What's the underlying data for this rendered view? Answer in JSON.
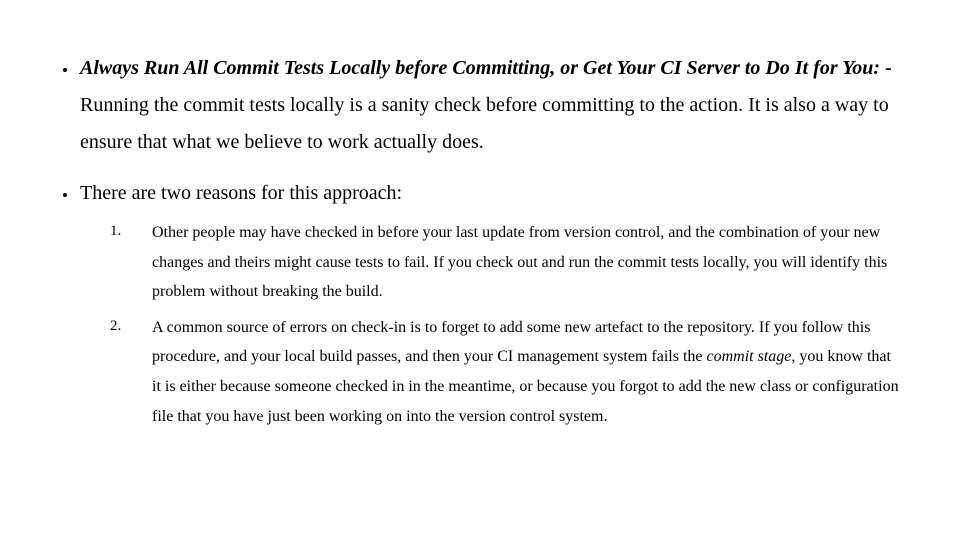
{
  "bullets": [
    {
      "heading": "Always Run All Commit Tests Locally before Committing, or Get Your CI Server to Do It for You: -",
      "body": " Running the commit tests locally is a sanity check before committing to the action. It is also a way to ensure that what we believe to work actually does."
    },
    {
      "intro": "There are two reasons for this approach:",
      "items": [
        "Other people may have checked in before your last update from version control, and the combination of your new changes and theirs might cause tests to fail. If you check out and run the commit tests locally, you will identify this problem without breaking the build.",
        {
          "pre": " A common source of errors on check-in is to forget to add some new artefact to the repository. If you follow this procedure, and your local build passes, and then your CI management system fails the ",
          "em": "commit stage",
          "post": ", you know that it is either because someone checked in in the meantime, or because you forgot to add the new class or configuration file that you have just been working on into the version control system."
        }
      ]
    }
  ]
}
